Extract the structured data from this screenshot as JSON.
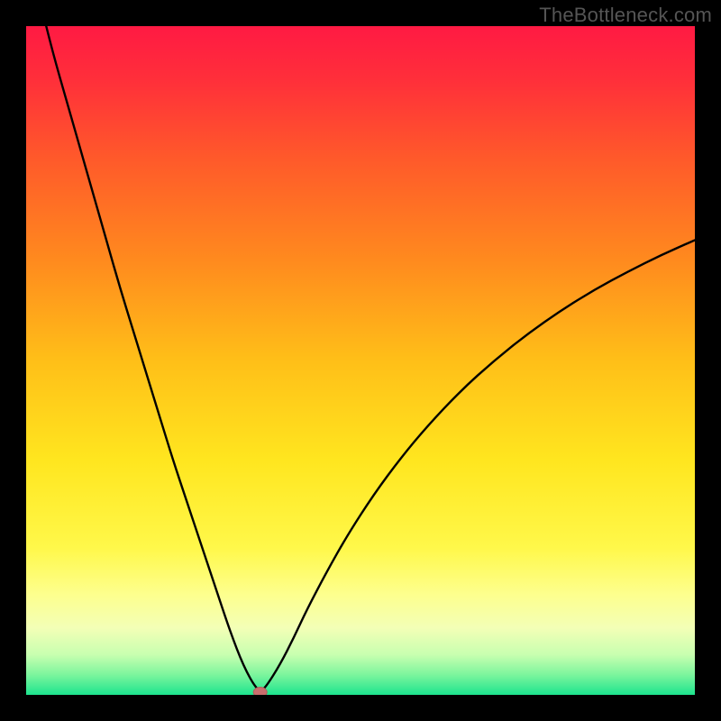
{
  "watermark": "TheBottleneck.com",
  "colors": {
    "frame": "#000000",
    "curve": "#000000",
    "marker_fill": "#c96d6d",
    "marker_stroke": "#b25d5d",
    "gradient_stops": [
      {
        "offset": 0.0,
        "color": "#ff1a43"
      },
      {
        "offset": 0.08,
        "color": "#ff2f3a"
      },
      {
        "offset": 0.2,
        "color": "#ff5a2a"
      },
      {
        "offset": 0.35,
        "color": "#ff8a1e"
      },
      {
        "offset": 0.5,
        "color": "#ffbf18"
      },
      {
        "offset": 0.65,
        "color": "#ffe61f"
      },
      {
        "offset": 0.78,
        "color": "#fff84a"
      },
      {
        "offset": 0.85,
        "color": "#fdff8e"
      },
      {
        "offset": 0.9,
        "color": "#f3ffb6"
      },
      {
        "offset": 0.94,
        "color": "#c8ffb0"
      },
      {
        "offset": 0.97,
        "color": "#7cf59d"
      },
      {
        "offset": 1.0,
        "color": "#1de48e"
      }
    ]
  },
  "chart_data": {
    "type": "line",
    "title": "",
    "xlabel": "",
    "ylabel": "",
    "xlim": [
      0,
      100
    ],
    "ylim": [
      0,
      100
    ],
    "grid": false,
    "series": [
      {
        "name": "bottleneck-curve",
        "x": [
          3,
          4,
          6,
          8,
          10,
          12,
          14,
          16,
          18,
          20,
          22,
          24,
          26,
          28,
          30,
          31,
          32,
          33,
          34,
          35,
          36,
          38,
          40,
          42,
          45,
          48,
          52,
          56,
          60,
          65,
          70,
          75,
          80,
          85,
          90,
          95,
          100
        ],
        "y": [
          100,
          96,
          89,
          82,
          75,
          68,
          61,
          54.5,
          48,
          41.5,
          35,
          29,
          23,
          17,
          11,
          8.2,
          5.6,
          3.4,
          1.6,
          0.4,
          1.4,
          4.6,
          8.5,
          12.8,
          18.5,
          23.8,
          30.0,
          35.4,
          40.2,
          45.5,
          50.0,
          54.0,
          57.5,
          60.6,
          63.3,
          65.8,
          68.0
        ]
      }
    ],
    "marker": {
      "x": 35,
      "y": 0.4,
      "label": ""
    }
  }
}
